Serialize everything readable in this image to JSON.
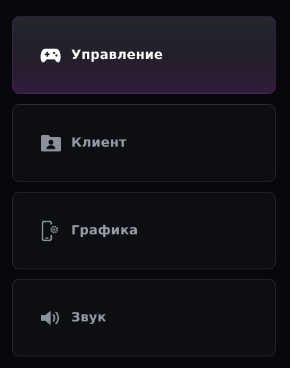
{
  "menu": {
    "items": [
      {
        "label": "Управление",
        "icon": "gamepad-icon",
        "active": true
      },
      {
        "label": "Клиент",
        "icon": "user-folder-icon",
        "active": false
      },
      {
        "label": "Графика",
        "icon": "phone-settings-icon",
        "active": false
      },
      {
        "label": "Звук",
        "icon": "speaker-icon",
        "active": false
      }
    ]
  },
  "colors": {
    "background": "#06080c",
    "item_background": "#0c0e13",
    "item_border": "#2b2d33",
    "active_border": "#4c2559",
    "active_gradient_bottom": "#321b3d",
    "active_text": "#ffffff",
    "inactive_text": "#9a9ca3"
  }
}
